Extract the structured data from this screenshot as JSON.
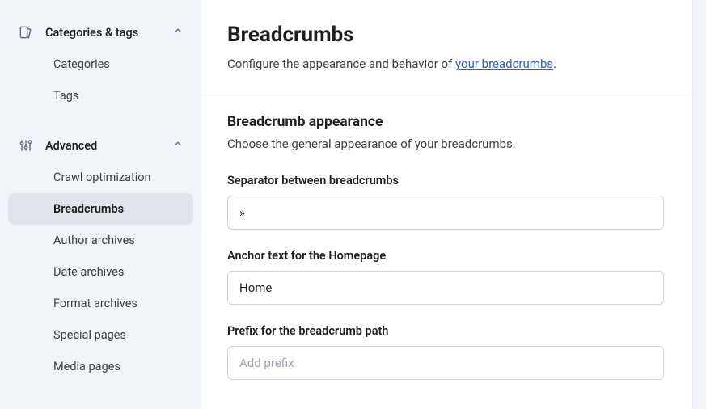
{
  "sidebar": {
    "sections": [
      {
        "label": "Categories & tags",
        "items": [
          {
            "label": "Categories"
          },
          {
            "label": "Tags"
          }
        ]
      },
      {
        "label": "Advanced",
        "items": [
          {
            "label": "Crawl optimization"
          },
          {
            "label": "Breadcrumbs"
          },
          {
            "label": "Author archives"
          },
          {
            "label": "Date archives"
          },
          {
            "label": "Format archives"
          },
          {
            "label": "Special pages"
          },
          {
            "label": "Media pages"
          }
        ]
      }
    ]
  },
  "main": {
    "title": "Breadcrumbs",
    "subtitle_prefix": "Configure the appearance and behavior of ",
    "subtitle_link": "your breadcrumbs",
    "subtitle_suffix": "."
  },
  "appearance": {
    "title": "Breadcrumb appearance",
    "subtitle": "Choose the general appearance of your breadcrumbs.",
    "fields": {
      "separator": {
        "label": "Separator between breadcrumbs",
        "value": "»"
      },
      "anchor": {
        "label": "Anchor text for the Homepage",
        "value": "Home"
      },
      "prefix": {
        "label": "Prefix for the breadcrumb path",
        "value": "",
        "placeholder": "Add prefix"
      }
    }
  }
}
